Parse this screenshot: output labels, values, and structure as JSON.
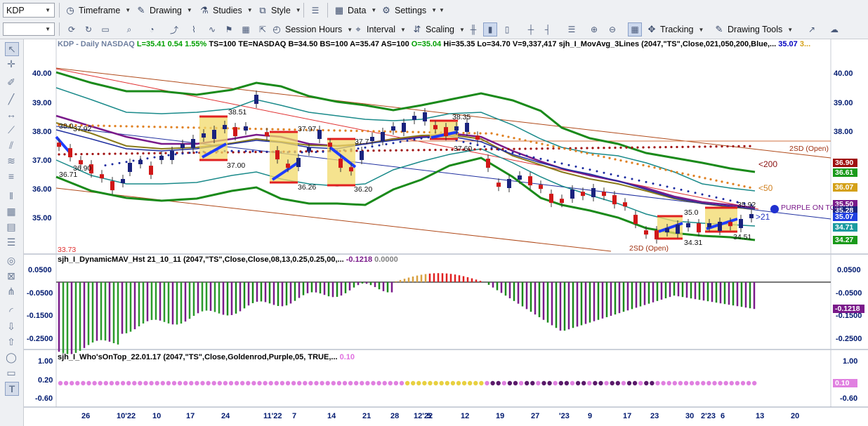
{
  "toolbar1": {
    "symbol": "KDP",
    "items": [
      "Timeframe",
      "Drawing",
      "Studies",
      "Style",
      "Data",
      "Settings"
    ]
  },
  "toolbar2": {
    "session": "Session Hours",
    "interval": "Interval",
    "scaling": "Scaling",
    "tracking": "Tracking",
    "drawing_tools": "Drawing Tools"
  },
  "price_pane": {
    "header_parts": [
      {
        "text": "KDP - Daily  NASDAQ",
        "color": "#6e7f9f"
      },
      {
        "text": "L=35.41",
        "color": "#00a000"
      },
      {
        "text": "0.54",
        "color": "#00a000"
      },
      {
        "text": "1.55%",
        "color": "#00a000"
      },
      {
        "text": "TS=100",
        "color": "#000000"
      },
      {
        "text": "TE=NASDAQ",
        "color": "#000000"
      },
      {
        "text": "B=34.50",
        "color": "#000000"
      },
      {
        "text": "BS=100",
        "color": "#000000"
      },
      {
        "text": "A=35.47",
        "color": "#000000"
      },
      {
        "text": "AS=100",
        "color": "#000000"
      },
      {
        "text": "O=35.04",
        "color": "#00a000"
      },
      {
        "text": "Hi=35.35",
        "color": "#000000"
      },
      {
        "text": "Lo=34.70",
        "color": "#000000"
      },
      {
        "text": "V=9,337,417",
        "color": "#000000"
      },
      {
        "text": "sjh_I_MovAvg_3Lines (2047,\"TS\",Close,021,050,200,Blue,...",
        "color": "#000000"
      },
      {
        "text": "35.07",
        "color": "#0000c0"
      },
      {
        "text": "3...",
        "color": "#d4a017"
      }
    ],
    "y_ticks": [
      "40.00",
      "39.00",
      "38.00",
      "37.00",
      "36.00",
      "35.00"
    ],
    "price_tags": [
      {
        "label": "36.90",
        "color": "#a01010"
      },
      {
        "label": "36.61",
        "color": "#1a9a1a"
      },
      {
        "label": "36.07",
        "color": "#d4a017"
      },
      {
        "label": "35.50",
        "color": "#7a1a8a"
      },
      {
        "label": "35.28",
        "color": "#1a237e"
      },
      {
        "label": "35.07",
        "color": "#2040e0"
      },
      {
        "label": "34.71",
        "color": "#1a9aa0"
      },
      {
        "label": "34.27",
        "color": "#1a9a1a"
      }
    ],
    "annotations": [
      "38.51",
      "37.00",
      "37.97",
      "36.26",
      "37.7",
      "36.20",
      "38.35",
      "37.60",
      "36.90",
      "36.71",
      "38.0",
      "37.92",
      "35.0",
      "34.31",
      "35.92",
      "34.51",
      "2SD (Open)",
      "2SD (Open)",
      "<200",
      "<50",
      ">21",
      "PURPLE ON TOP",
      "33.73"
    ]
  },
  "hist_pane": {
    "header_parts": [
      {
        "text": "sjh_I_DynamicMAV_Hst 21_10_11 (2047,\"TS\",Close,Close,08,13,0.25,0.25,00,...",
        "color": "#000000"
      },
      {
        "text": "-0.1218",
        "color": "#7a1a8a"
      },
      {
        "text": "0.0000",
        "color": "#808080"
      }
    ],
    "y_ticks": [
      "0.0500",
      "-0.0500",
      "-0.1500",
      "-0.2500"
    ],
    "tag": {
      "label": "-0.1218",
      "color": "#7a1a8a"
    }
  },
  "who_pane": {
    "header_parts": [
      {
        "text": "sjh_I_Who'sOnTop_22.01.17 (2047,\"TS\",Close,Goldenrod,Purple,05, TRUE,...",
        "color": "#000000"
      },
      {
        "text": "0.10",
        "color": "#e070e0"
      }
    ],
    "y_ticks": [
      "1.00",
      "0.20",
      "-0.60"
    ],
    "tag": {
      "label": "0.10",
      "color": "#e080e0"
    }
  },
  "x_axis": [
    "26",
    "10'22",
    "10",
    "17",
    "24",
    "11'22",
    "7",
    "14",
    "21",
    "28",
    "12'22",
    "5",
    "12",
    "19",
    "27",
    "'23",
    "9",
    "17",
    "23",
    "30",
    "2'23",
    "6",
    "13",
    "20"
  ],
  "chart_data": {
    "type": "candlestick",
    "symbol": "KDP",
    "interval": "Daily",
    "last_close": 35.41,
    "open": 35.04,
    "high": 35.35,
    "low": 34.7,
    "volume": 9337417,
    "ylim": [
      33.7,
      40.5
    ],
    "ma_values": {
      "ma200": 36.9,
      "ma50": 36.07,
      "ma21": 35.28
    },
    "histogram_last": -0.1218,
    "who_on_top_last": 0.1
  }
}
